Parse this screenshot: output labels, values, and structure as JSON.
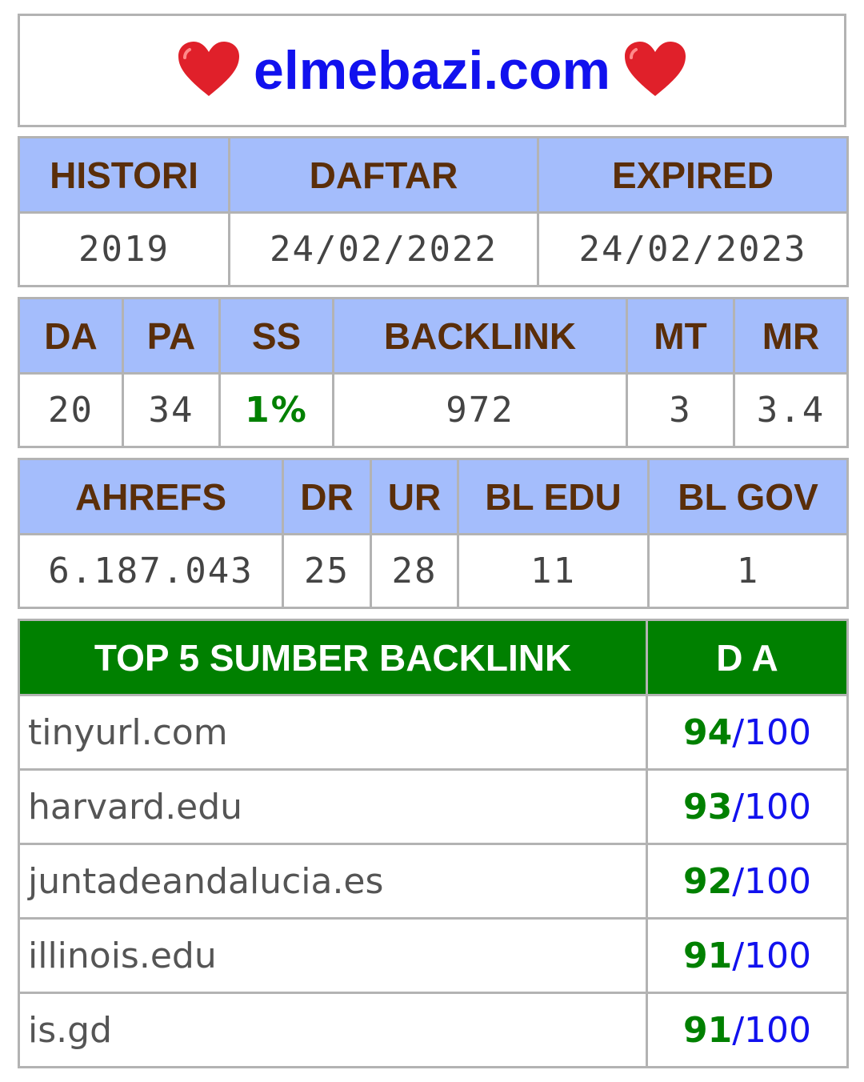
{
  "header": {
    "left_icon": "heart-icon",
    "title": "elmebazi.com",
    "right_icon": "heart-icon",
    "heart_color": "#e0202a",
    "title_color": "#1111ee"
  },
  "dates": {
    "headers": [
      "HISTORI",
      "DAFTAR",
      "EXPIRED"
    ],
    "values": [
      "2019",
      "24/02/2022",
      "24/02/2023"
    ]
  },
  "metrics": {
    "headers": [
      "DA",
      "PA",
      "SS",
      "BACKLINK",
      "MT",
      "MR"
    ],
    "values": [
      "20",
      "34",
      "1%",
      "972",
      "3",
      "3.4"
    ]
  },
  "ahrefs": {
    "headers": [
      "AHREFS",
      "DR",
      "UR",
      "BL EDU",
      "BL GOV"
    ],
    "values": [
      "6.187.043",
      "25",
      "28",
      "11",
      "1"
    ]
  },
  "top_backlinks": {
    "headers": [
      "TOP 5 SUMBER BACKLINK",
      "D A"
    ],
    "header_color": "#008000",
    "rows": [
      {
        "source": "tinyurl.com",
        "da": "94",
        "max": "/100"
      },
      {
        "source": "harvard.edu",
        "da": "93",
        "max": "/100"
      },
      {
        "source": "juntadeandalucia.es",
        "da": "92",
        "max": "/100"
      },
      {
        "source": "illinois.edu",
        "da": "91",
        "max": "/100"
      },
      {
        "source": "is.gd",
        "da": "91",
        "max": "/100"
      }
    ]
  },
  "colors": {
    "header_bg": "#a4bdfc",
    "header_text": "#5a2e0a",
    "border": "#b3b3b3"
  }
}
